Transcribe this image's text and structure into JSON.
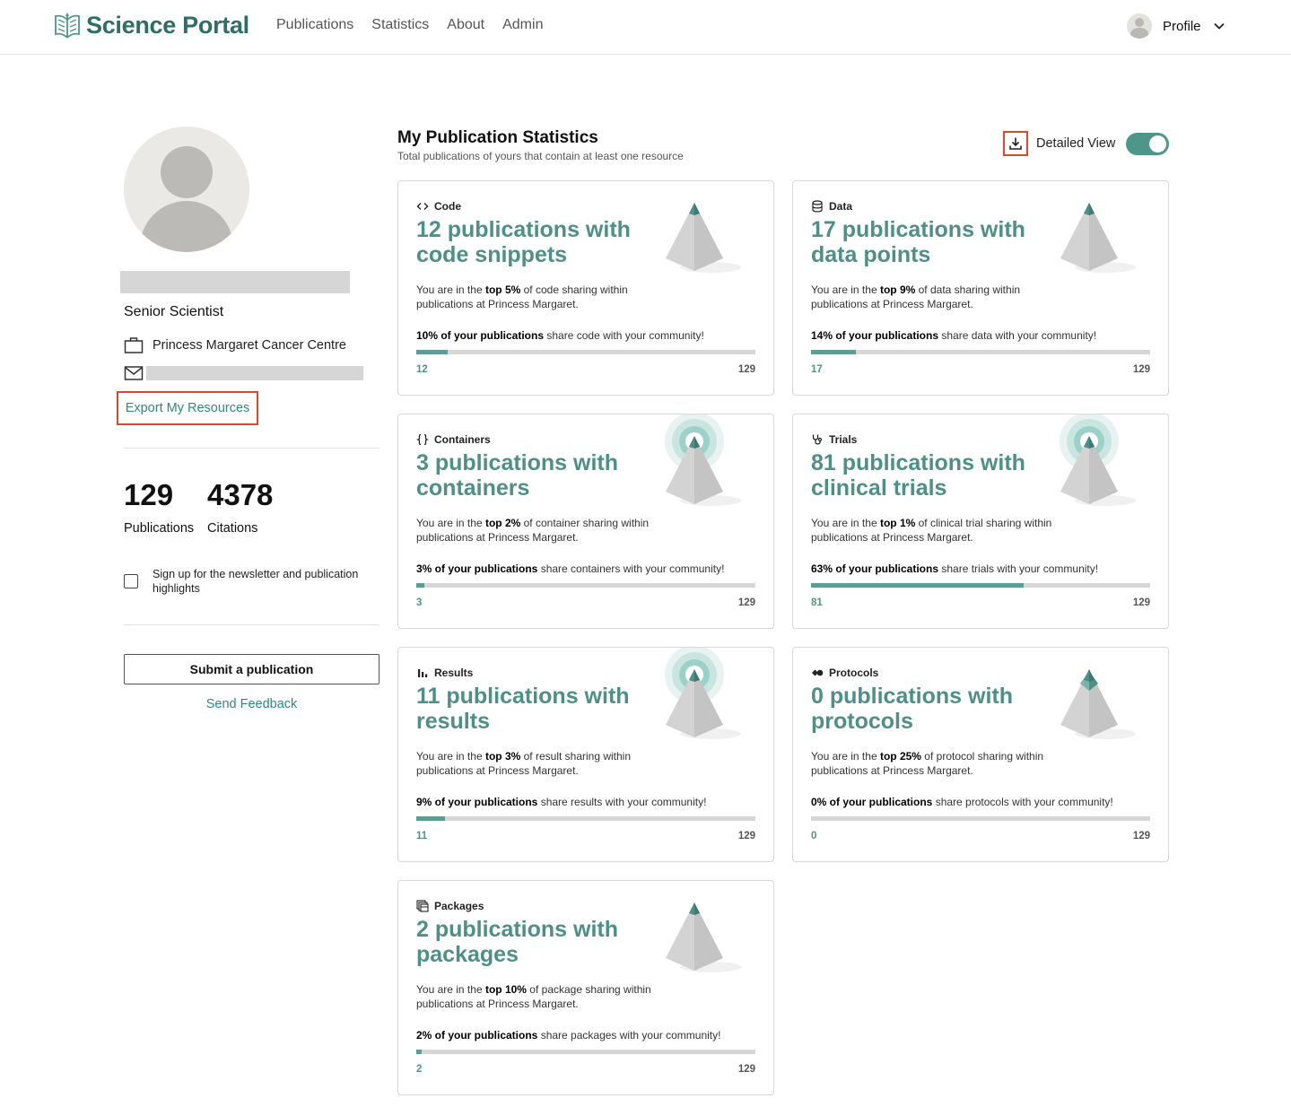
{
  "header": {
    "brand": "Science Portal",
    "nav": [
      "Publications",
      "Statistics",
      "About",
      "Admin"
    ],
    "profile_label": "Profile"
  },
  "sidebar": {
    "job_title": "Senior Scientist",
    "organization": "Princess Margaret Cancer Centre",
    "export_label": "Export My Resources",
    "stats": [
      {
        "value": "129",
        "label": "Publications"
      },
      {
        "value": "4378",
        "label": "Citations"
      }
    ],
    "newsletter_text": "Sign up for the newsletter and publication highlights",
    "newsletter_checked": false,
    "submit_label": "Submit a publication",
    "feedback_label": "Send Feedback"
  },
  "main": {
    "title": "My Publication Statistics",
    "subtitle": "Total publications of yours that contain at least one resource",
    "detailed_view_label": "Detailed View",
    "detailed_view_on": true,
    "accent_color": "#4e958a",
    "cards": [
      {
        "category": "Code",
        "icon": "code-icon",
        "title": "12 publications with code snippets",
        "desc_pre": "You are in the ",
        "desc_rank": "top 5%",
        "desc_post": " of code sharing within publications at Princess Margaret.",
        "share_bold": "10% of your publications",
        "share_rest": " share code with your community!",
        "count": "12",
        "total": "129",
        "ratio": 0.093,
        "glow": false,
        "top_color": "#4e8f87"
      },
      {
        "category": "Data",
        "icon": "database-icon",
        "title": "17 publications with data points",
        "desc_pre": "You are in the ",
        "desc_rank": "top 9%",
        "desc_post": " of data sharing within publications at Princess Margaret.",
        "share_bold": "14% of your publications",
        "share_rest": " share data with your community!",
        "count": "17",
        "total": "129",
        "ratio": 0.132,
        "glow": false,
        "top_color": "#4e8f87"
      },
      {
        "category": "Containers",
        "icon": "braces-icon",
        "title": "3 publications with containers",
        "desc_pre": "You are in the ",
        "desc_rank": "top 2%",
        "desc_post": " of container sharing within publications at Princess Margaret.",
        "share_bold": "3% of your publications",
        "share_rest": " share containers with your community!",
        "count": "3",
        "total": "129",
        "ratio": 0.023,
        "glow": true,
        "top_color": "#4e8f87"
      },
      {
        "category": "Trials",
        "icon": "stethoscope-icon",
        "title": "81 publications with clinical trials",
        "desc_pre": "You are in the ",
        "desc_rank": "top 1%",
        "desc_post": " of clinical trial sharing within publications at Princess Margaret.",
        "share_bold": "63% of your publications",
        "share_rest": " share trials with your community!",
        "count": "81",
        "total": "129",
        "ratio": 0.628,
        "glow": true,
        "top_color": "#4e8f87"
      },
      {
        "category": "Results",
        "icon": "bar-chart-icon",
        "title": "11 publications with results",
        "desc_pre": "You are in the ",
        "desc_rank": "top 3%",
        "desc_post": " of result sharing within publications at Princess Margaret.",
        "share_bold": "9% of your publications",
        "share_rest": " share results with your community!",
        "count": "11",
        "total": "129",
        "ratio": 0.085,
        "glow": true,
        "top_color": "#4e8f87"
      },
      {
        "category": "Protocols",
        "icon": "protocol-icon",
        "title": "0 publications with protocols",
        "desc_pre": "You are in the ",
        "desc_rank": "top 25%",
        "desc_post": " of protocol sharing within publications at Princess Margaret.",
        "share_bold": "0% of your publications",
        "share_rest": " share protocols with your community!",
        "count": "0",
        "total": "129",
        "ratio": 0,
        "glow": false,
        "top_color": "#4e8f87",
        "mid_color": "#7eb3ab"
      },
      {
        "category": "Packages",
        "icon": "package-icon",
        "title": "2 publications with packages",
        "desc_pre": "You are in the ",
        "desc_rank": "top 10%",
        "desc_post": " of package sharing within publications at Princess Margaret.",
        "share_bold": "2% of your publications",
        "share_rest": " share packages with your community!",
        "count": "2",
        "total": "129",
        "ratio": 0.016,
        "glow": false,
        "top_color": "#4e8f87"
      }
    ]
  }
}
